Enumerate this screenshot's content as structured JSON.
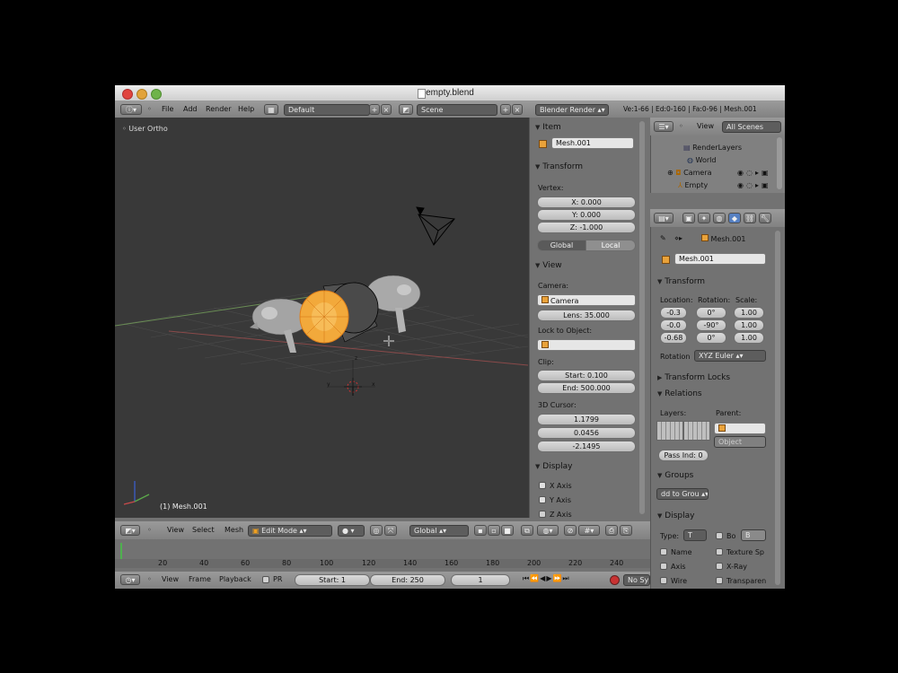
{
  "window": {
    "title": "empty.blend"
  },
  "info_header": {
    "menus": [
      "File",
      "Add",
      "Render",
      "Help"
    ],
    "layout": "Default",
    "scene": "Scene",
    "engine": "Blender Render",
    "stats": "Ve:1-66 | Ed:0-160 | Fa:0-96 | Mesh.001"
  },
  "viewport": {
    "view_label": "User Ortho",
    "object_label": "(1) Mesh.001",
    "axis_z": "z",
    "axis_x": "x",
    "axis_y": "y"
  },
  "viewport_header": {
    "menus": [
      "View",
      "Select",
      "Mesh"
    ],
    "mode": "Edit Mode",
    "orientation": "Global"
  },
  "npanel": {
    "item": {
      "header": "Item",
      "name": "Mesh.001"
    },
    "transform": {
      "header": "Transform",
      "vertex_label": "Vertex:",
      "x": "X: 0.000",
      "y": "Y: 0.000",
      "z": "Z: -1.000",
      "global": "Global",
      "local": "Local"
    },
    "view": {
      "header": "View",
      "camera_label": "Camera:",
      "camera": "Camera",
      "lens": "Lens: 35.000",
      "lock_label": "Lock to Object:",
      "clip_label": "Clip:",
      "start": "Start: 0.100",
      "end": "End: 500.000",
      "cursor_label": "3D Cursor:",
      "cursor": [
        "1.1799",
        "0.0456",
        "-2.1495"
      ]
    },
    "display": {
      "header": "Display",
      "x_axis": "X Axis",
      "y_axis": "Y Axis",
      "z_axis": "Z Axis"
    }
  },
  "outliner": {
    "view": "View",
    "filter": "All Scenes",
    "items": [
      "RenderLayers",
      "World",
      "Camera",
      "Empty"
    ]
  },
  "properties": {
    "name": "Mesh.001",
    "datablock": "Mesh.001",
    "transform": {
      "header": "Transform",
      "location_label": "Location:",
      "rotation_label": "Rotation:",
      "scale_label": "Scale:",
      "location": [
        "-0.3",
        "-0.0",
        "-0.68"
      ],
      "rotation": [
        "0°",
        "-90°",
        "0°"
      ],
      "scale": [
        "1.00",
        "1.00",
        "1.00"
      ],
      "mode_label": "Rotation",
      "mode": "XYZ Euler"
    },
    "transform_locks": "Transform Locks",
    "relations": {
      "header": "Relations",
      "layers_label": "Layers:",
      "parent_label": "Parent:",
      "parent_type": "Object",
      "pass_index": "Pass Ind: 0"
    },
    "groups": {
      "header": "Groups",
      "add": "dd to Grou"
    },
    "display": {
      "header": "Display",
      "type_label": "Type:",
      "type_value": "T",
      "bo": "Bo",
      "bo_value": "B",
      "name": "Name",
      "texture": "Texture Sp",
      "axis": "Axis",
      "xray": "X-Ray",
      "wire": "Wire",
      "transparent": "Transparen"
    }
  },
  "timeline": {
    "ticks": [
      "20",
      "40",
      "60",
      "80",
      "100",
      "120",
      "140",
      "160",
      "180",
      "200",
      "220",
      "240"
    ],
    "menus": [
      "View",
      "Frame",
      "Playback"
    ],
    "pr": "PR",
    "start": "Start: 1",
    "end": "End: 250",
    "current": "1",
    "sync": "No Sync"
  },
  "colors": {
    "accent": "#5680c2",
    "selection": "#f0a020",
    "viewport_bg": "#393939"
  }
}
